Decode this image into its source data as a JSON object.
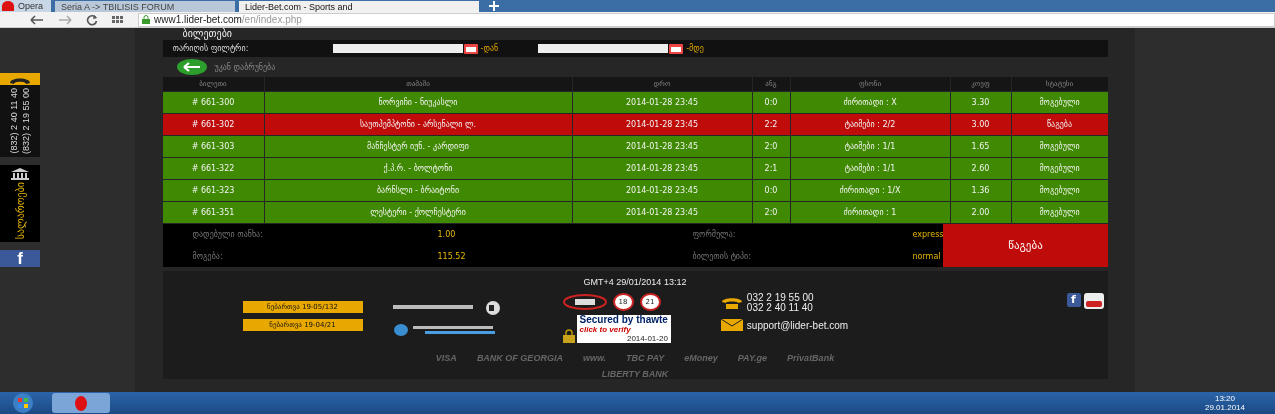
{
  "browser": {
    "menu_label": "Opera",
    "tabs": [
      {
        "label": "Seria A -> TBILISIS FORUM",
        "selected": false
      },
      {
        "label": "Lider-Bet.com - Sports and",
        "selected": true
      }
    ],
    "url_host": "www1.lider-bet.com",
    "url_path": "/en/index.php"
  },
  "sidebar": {
    "phones": [
      "(832) 2 40 11 40",
      "(832) 2 19 55 00"
    ],
    "cashier_label": "სალაროები",
    "facebook_glyph": "f"
  },
  "page_title": "ბილეთები",
  "filter": {
    "label": "თარიღის ფილტრი:",
    "from_suffix": "-დან",
    "to_suffix": "-მდე"
  },
  "back_link": "უკან დაბრუნება",
  "table": {
    "columns": [
      "ბილეთი",
      "თამაში",
      "დრო",
      "ანგ",
      "ფსონი",
      "კოეფ",
      "სტატუსი"
    ],
    "rows": [
      {
        "ticket": "# 661-300",
        "game": "ნორვიჩი - ნიუკასლი",
        "time": "2014-01-28 23:45",
        "score": "0:0",
        "bet": "ძირითადი : X",
        "coef": "3.30",
        "status": "მოგებული",
        "won": true
      },
      {
        "ticket": "# 661-302",
        "game": "საუთჰემპტონი - არსენალი ლ.",
        "time": "2014-01-28 23:45",
        "score": "2:2",
        "bet": "ტაიმები : 2/2",
        "coef": "3.00",
        "status": "წაგება",
        "won": false
      },
      {
        "ticket": "# 661-303",
        "game": "მანჩესტერ იუნ. - კარდიფი",
        "time": "2014-01-28 23:45",
        "score": "2:0",
        "bet": "ტაიმები : 1/1",
        "coef": "1.65",
        "status": "მოგებული",
        "won": true
      },
      {
        "ticket": "# 661-322",
        "game": "ქ.პ.რ. - ბოლტონი",
        "time": "2014-01-28 23:45",
        "score": "2:1",
        "bet": "ტაიმები : 1/1",
        "coef": "2.60",
        "status": "მოგებული",
        "won": true
      },
      {
        "ticket": "# 661-323",
        "game": "ბარნსლი - ბრაიტონი",
        "time": "2014-01-28 23:45",
        "score": "0:0",
        "bet": "ძირითადი : 1/X",
        "coef": "1.36",
        "status": "მოგებული",
        "won": true
      },
      {
        "ticket": "# 661-351",
        "game": "ლესტერი - ქოლჩესტერი",
        "time": "2014-01-28 23:45",
        "score": "2:0",
        "bet": "ძირითადი : 1",
        "coef": "2.00",
        "status": "მოგებული",
        "won": true
      }
    ]
  },
  "summary": {
    "fields": [
      {
        "label": "დადებული თანხა:",
        "value": "1.00"
      },
      {
        "label": "ფორმულა:",
        "value": "express"
      },
      {
        "label": "მოგება:",
        "value": "115.52"
      },
      {
        "label": "ბილეთის ტიპი:",
        "value": "normal"
      }
    ],
    "result": "წაგება",
    "won": false
  },
  "footer": {
    "clock": "GMT+4 29/01/2014 13:12",
    "licenses": [
      "ნებართვა 19-05/132",
      "ნებართვა 19-04/21"
    ],
    "ages": [
      "18",
      "21"
    ],
    "thawte": {
      "title": "Secured by thawte",
      "sub": "click to verify",
      "date": "2014-01-20"
    },
    "phones": [
      "032 2 19 55 00",
      "032 2 40 11 40"
    ],
    "email": "support@lider-bet.com",
    "facebook_glyph": "f",
    "payments": [
      "VISA",
      "BANK OF GEORGIA",
      "www.",
      "TBC PAY",
      "eMoney",
      "PAY.ge",
      "PrivatBank",
      "LIBERTY BANK"
    ]
  },
  "taskbar": {
    "time": "13:20",
    "date": "29.01.2014"
  }
}
